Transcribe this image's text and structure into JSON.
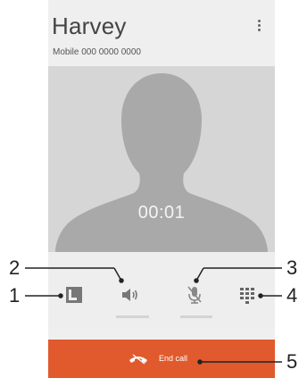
{
  "contact": {
    "name": "Harvey",
    "subtitle": "Mobile 000 0000 0000"
  },
  "call": {
    "timer": "00:01"
  },
  "controls": {
    "contacts_icon": "contacts-icon",
    "speaker_icon": "speaker-icon",
    "mute_icon": "mic-off-icon",
    "dialpad_icon": "dialpad-icon"
  },
  "end_call": {
    "label": "End call",
    "icon": "end-call-icon",
    "color": "#e05a2e"
  },
  "callouts": {
    "one": "1",
    "two": "2",
    "three": "3",
    "four": "4",
    "five": "5"
  }
}
